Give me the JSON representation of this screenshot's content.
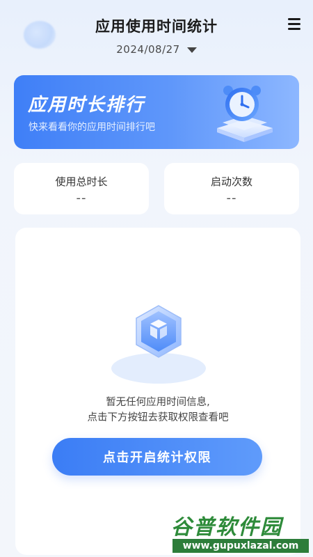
{
  "header": {
    "title": "应用使用时间统计",
    "date": "2024/08/27",
    "menu_icon": "menu-icon",
    "date_dropdown_icon": "caret-down-icon"
  },
  "banner": {
    "title": "应用时长排行",
    "subtitle": "快来看看你的应用时间排行吧",
    "icon": "alarm-clock-icon"
  },
  "stats": [
    {
      "label": "使用总时长",
      "value": "--"
    },
    {
      "label": "启动次数",
      "value": "--"
    }
  ],
  "empty_state": {
    "icon": "cube-box-icon",
    "line1": "暂无任何应用时间信息,",
    "line2": "点击下方按钮去获取权限查看吧",
    "button_label": "点击开启统计权限"
  },
  "watermark": {
    "name": "谷普软件园",
    "url": "www.gupuxlazal.com"
  },
  "colors": {
    "accent": "#3f7ff7",
    "background": "#f3f6fb",
    "watermark_green": "#2e8b3a"
  }
}
